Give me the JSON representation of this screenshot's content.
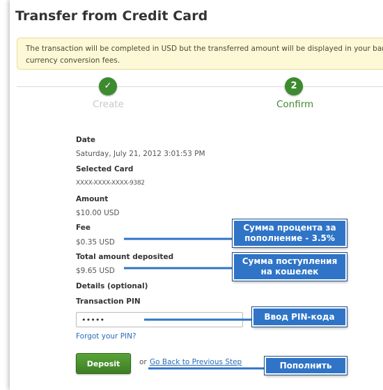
{
  "page": {
    "title": "Transfer from Credit Card"
  },
  "notice": {
    "line1": "The transaction will be completed in USD but the transferred amount will be displayed in your bank a",
    "line2": "currency conversion fees."
  },
  "steps": [
    {
      "label": "Create",
      "marker": "✓",
      "state": "done"
    },
    {
      "label": "Confirm",
      "marker": "2",
      "state": "active"
    }
  ],
  "details": {
    "date_label": "Date",
    "date_value": "Saturday, July 21, 2012 3:01:53 PM",
    "card_label": "Selected Card",
    "card_value": "XXXX-XXXX-XXXX-9382",
    "amount_label": "Amount",
    "amount_value": "$10.00 USD",
    "fee_label": "Fee",
    "fee_value": "$0.35 USD",
    "total_label": "Total amount deposited",
    "total_value": "$9.65 USD",
    "details_label": "Details (optional)",
    "pin_label": "Transaction PIN",
    "pin_value": "•••••"
  },
  "links": {
    "forgot_pin": "Forgot your PIN?",
    "or": "or",
    "go_back": "Go Back to Previous Step"
  },
  "buttons": {
    "deposit": "Deposit"
  },
  "annotations": {
    "fee_line1": "Сумма процента за",
    "fee_line2": "пополнение - 3.5%",
    "total_line1": "Сумма поступления",
    "total_line2": "на кошелек",
    "pin": "Ввод PIN-кода",
    "deposit": "Пополнить"
  },
  "colors": {
    "accent_green": "#3d8b2f",
    "callout_blue": "#2f74c7",
    "link_blue": "#2a6bb8",
    "notice_bg": "#fdf8d6"
  }
}
